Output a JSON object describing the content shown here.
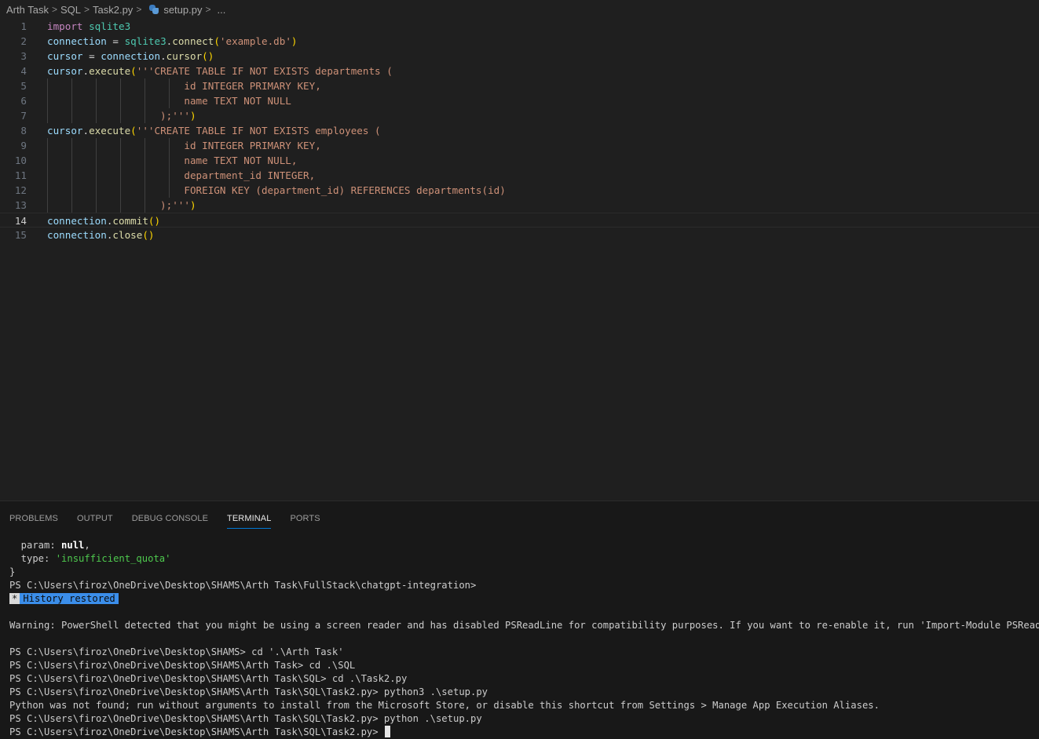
{
  "breadcrumb": {
    "items": [
      "Arth Task",
      "SQL",
      "Task2.py",
      "setup.py",
      "..."
    ],
    "separator": ">"
  },
  "editor": {
    "active_line": 14,
    "lines": [
      {
        "n": "1",
        "guides": 0,
        "tokens": [
          {
            "t": "import",
            "c": "kw"
          },
          {
            "t": " ",
            "c": "op"
          },
          {
            "t": "sqlite3",
            "c": "mod"
          }
        ]
      },
      {
        "n": "2",
        "guides": 0,
        "tokens": [
          {
            "t": "connection",
            "c": "var"
          },
          {
            "t": " = ",
            "c": "op"
          },
          {
            "t": "sqlite3",
            "c": "mod"
          },
          {
            "t": ".",
            "c": "op"
          },
          {
            "t": "connect",
            "c": "fn"
          },
          {
            "t": "(",
            "c": "p1"
          },
          {
            "t": "'example.db'",
            "c": "str"
          },
          {
            "t": ")",
            "c": "p1"
          }
        ]
      },
      {
        "n": "3",
        "guides": 0,
        "tokens": [
          {
            "t": "cursor",
            "c": "var"
          },
          {
            "t": " = ",
            "c": "op"
          },
          {
            "t": "connection",
            "c": "var"
          },
          {
            "t": ".",
            "c": "op"
          },
          {
            "t": "cursor",
            "c": "fn"
          },
          {
            "t": "()",
            "c": "p1"
          }
        ]
      },
      {
        "n": "4",
        "guides": 0,
        "tokens": [
          {
            "t": "cursor",
            "c": "var"
          },
          {
            "t": ".",
            "c": "op"
          },
          {
            "t": "execute",
            "c": "fn"
          },
          {
            "t": "(",
            "c": "p1"
          },
          {
            "t": "'''CREATE TABLE IF NOT EXISTS departments (",
            "c": "str"
          }
        ]
      },
      {
        "n": "5",
        "guides": 6,
        "tokens": [
          {
            "t": "                       id INTEGER PRIMARY KEY,",
            "c": "str"
          }
        ]
      },
      {
        "n": "6",
        "guides": 6,
        "tokens": [
          {
            "t": "                       name TEXT NOT NULL",
            "c": "str"
          }
        ]
      },
      {
        "n": "7",
        "guides": 5,
        "tokens": [
          {
            "t": "                   );'''",
            "c": "str"
          },
          {
            "t": ")",
            "c": "p1"
          }
        ]
      },
      {
        "n": "8",
        "guides": 0,
        "tokens": [
          {
            "t": "cursor",
            "c": "var"
          },
          {
            "t": ".",
            "c": "op"
          },
          {
            "t": "execute",
            "c": "fn"
          },
          {
            "t": "(",
            "c": "p1"
          },
          {
            "t": "'''CREATE TABLE IF NOT EXISTS employees (",
            "c": "str"
          }
        ]
      },
      {
        "n": "9",
        "guides": 6,
        "tokens": [
          {
            "t": "                       id INTEGER PRIMARY KEY,",
            "c": "str"
          }
        ]
      },
      {
        "n": "10",
        "guides": 6,
        "tokens": [
          {
            "t": "                       name TEXT NOT NULL,",
            "c": "str"
          }
        ]
      },
      {
        "n": "11",
        "guides": 6,
        "tokens": [
          {
            "t": "                       department_id INTEGER,",
            "c": "str"
          }
        ]
      },
      {
        "n": "12",
        "guides": 6,
        "tokens": [
          {
            "t": "                       FOREIGN KEY (department_id) REFERENCES departments(id)",
            "c": "str"
          }
        ]
      },
      {
        "n": "13",
        "guides": 5,
        "tokens": [
          {
            "t": "                   );'''",
            "c": "str"
          },
          {
            "t": ")",
            "c": "p1"
          }
        ]
      },
      {
        "n": "14",
        "guides": 0,
        "tokens": [
          {
            "t": "connection",
            "c": "var"
          },
          {
            "t": ".",
            "c": "op"
          },
          {
            "t": "commit",
            "c": "fn"
          },
          {
            "t": "()",
            "c": "p1"
          }
        ]
      },
      {
        "n": "15",
        "guides": 0,
        "tokens": [
          {
            "t": "connection",
            "c": "var"
          },
          {
            "t": ".",
            "c": "op"
          },
          {
            "t": "close",
            "c": "fn"
          },
          {
            "t": "()",
            "c": "p1"
          }
        ]
      }
    ]
  },
  "panel": {
    "tabs": [
      {
        "label": "PROBLEMS",
        "active": false
      },
      {
        "label": "OUTPUT",
        "active": false
      },
      {
        "label": "DEBUG CONSOLE",
        "active": false
      },
      {
        "label": "TERMINAL",
        "active": true
      },
      {
        "label": "PORTS",
        "active": false
      }
    ]
  },
  "terminal": {
    "param_key": "  param: ",
    "param_val": "null",
    "param_end": ",",
    "type_key": "  type: ",
    "type_val": "'insufficient_quota'",
    "close_brace": "}",
    "prompt_fullstack": "PS C:\\Users\\firoz\\OneDrive\\Desktop\\SHAMS\\Arth Task\\FullStack\\chatgpt-integration>",
    "history_star": "*",
    "history_text": "History restored",
    "warning": "Warning: PowerShell detected that you might be using a screen reader and has disabled PSReadLine for compatibility purposes. If you want to re-enable it, run 'Import-Module PSReadLine'.",
    "cmd1": "PS C:\\Users\\firoz\\OneDrive\\Desktop\\SHAMS> cd '.\\Arth Task'",
    "cmd2": "PS C:\\Users\\firoz\\OneDrive\\Desktop\\SHAMS\\Arth Task> cd .\\SQL",
    "cmd3": "PS C:\\Users\\firoz\\OneDrive\\Desktop\\SHAMS\\Arth Task\\SQL> cd .\\Task2.py",
    "cmd4": "PS C:\\Users\\firoz\\OneDrive\\Desktop\\SHAMS\\Arth Task\\SQL\\Task2.py> python3 .\\setup.py",
    "python_not_found": "Python was not found; run without arguments to install from the Microsoft Store, or disable this shortcut from Settings > Manage App Execution Aliases.",
    "cmd5": "PS C:\\Users\\firoz\\OneDrive\\Desktop\\SHAMS\\Arth Task\\SQL\\Task2.py> python .\\setup.py",
    "prompt_final": "PS C:\\Users\\firoz\\OneDrive\\Desktop\\SHAMS\\Arth Task\\SQL\\Task2.py> "
  }
}
